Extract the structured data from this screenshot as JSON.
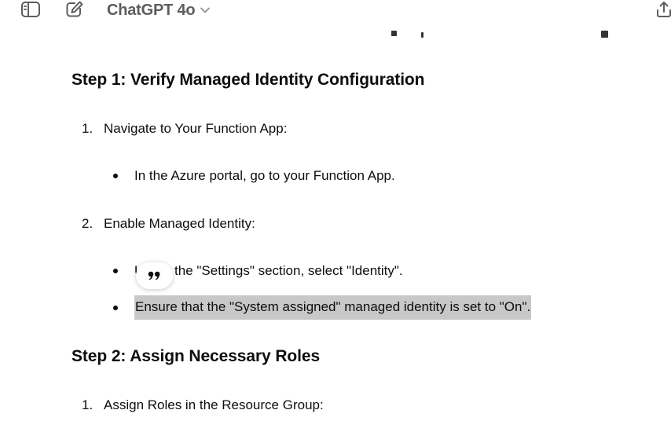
{
  "header": {
    "model_name": "ChatGPT 4o",
    "icons": [
      "sidebar-toggle-icon",
      "compose-icon",
      "chevron-down-icon",
      "share-icon"
    ]
  },
  "content": {
    "step1_heading": "Step 1: Verify Managed Identity Configuration",
    "step1_items": [
      {
        "number": "1.",
        "label": "Navigate to Your Function App:",
        "bullets": [
          "In the Azure portal, go to your Function App."
        ]
      },
      {
        "number": "2.",
        "label": "Enable Managed Identity:",
        "bullets": [
          "Under the \"Settings\" section, select \"Identity\".",
          "Ensure that the \"System assigned\" managed identity is set to \"On\"."
        ]
      }
    ],
    "step2_heading": "Step 2: Assign Necessary Roles",
    "step2_items": [
      {
        "number": "1.",
        "label": "Assign Roles in the Resource Group:"
      }
    ]
  },
  "colors": {
    "text": "#0d0d0d",
    "model_name": "#5d5d5d",
    "selection_highlight": "#c8c8c8",
    "background": "#ffffff"
  }
}
